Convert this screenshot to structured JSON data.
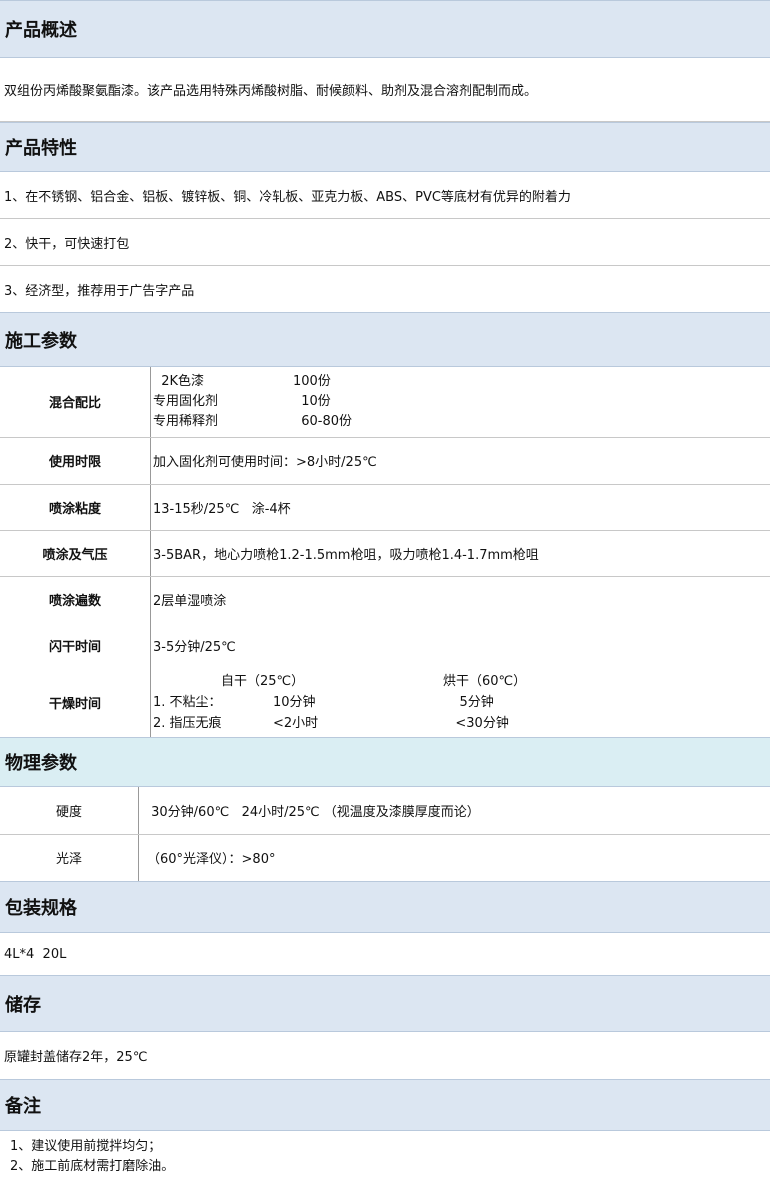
{
  "overview": {
    "title": "产品概述",
    "text": "双组份丙烯酸聚氨酯漆。该产品选用特殊丙烯酸树脂、耐候颜料、助剂及混合溶剂配制而成。"
  },
  "features": {
    "title": "产品特性",
    "items": [
      "1、在不锈钢、铝合金、铝板、镀锌板、铜、冷轧板、亚克力板、ABS、PVC等底材有优异的附着力",
      "2、快干，可快速打包",
      "3、经济型，推荐用于广告字产品"
    ]
  },
  "construction": {
    "title": "施工参数",
    "mix_label": "混合配比",
    "mix": [
      {
        "name": "  2K色漆",
        "amount": "100份"
      },
      {
        "name": "专用固化剂",
        "amount": "  10份"
      },
      {
        "name": "专用稀释剂",
        "amount": "  60-80份"
      }
    ],
    "pot_label": "使用时限",
    "pot_value": "加入固化剂可使用时间：>8小时/25℃",
    "visc_label": "喷涂粘度",
    "visc_value": "13-15秒/25℃   涂-4杯",
    "press_label": "喷涂及气压",
    "press_value": "3-5BAR，地心力喷枪1.2-1.5mm枪咀，吸力喷枪1.4-1.7mm枪咀",
    "coats_label": "喷涂遍数",
    "coats_value": "2层单湿喷涂",
    "flash_label": "闪干时间",
    "flash_value": "3-5分钟/25℃",
    "dry_label": "干燥时间",
    "dry_head_air": "自干（25℃）",
    "dry_head_bake": "烘干（60℃）",
    "dry_rows": [
      {
        "name": "1. 不粘尘：",
        "air": "10分钟",
        "bake": "    5分钟"
      },
      {
        "name": "2. 指压无痕",
        "air": "<2小时",
        "bake": "   <30分钟"
      }
    ]
  },
  "physical": {
    "title": "物理参数",
    "hardness_label": "硬度",
    "hardness_value": " 30分钟/60℃   24小时/25℃ （视温度及漆膜厚度而论）",
    "gloss_label": "光泽",
    "gloss_value": "（60°光泽仪）：>80°"
  },
  "packaging": {
    "title": "包装规格",
    "text": "4L*4  20L"
  },
  "storage": {
    "title": "储存",
    "text": "原罐封盖储存2年，25℃"
  },
  "remarks": {
    "title": "备注",
    "items": [
      "1、建议使用前搅拌均匀；",
      "2、施工前底材需打磨除油。"
    ]
  }
}
